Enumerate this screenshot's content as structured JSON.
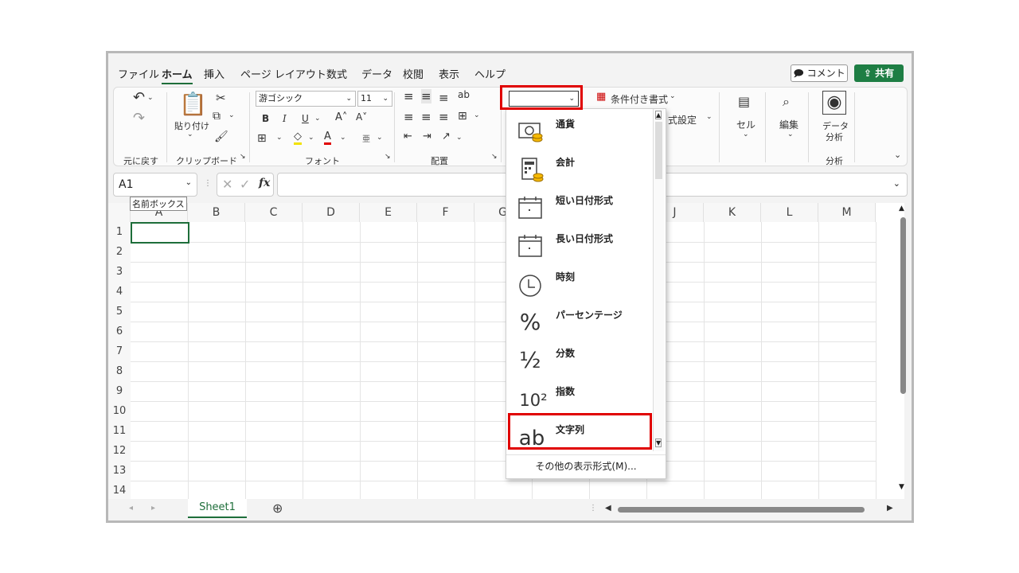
{
  "tabs": [
    "ファイル",
    "ホーム",
    "挿入",
    "ページ レイアウト",
    "数式",
    "データ",
    "校閲",
    "表示",
    "ヘルプ"
  ],
  "active_tab": "ホーム",
  "comment_label": "コメント",
  "share_label": "共有",
  "ribbon": {
    "undo_group": "元に戻す",
    "paste_label": "貼り付け",
    "clipboard_group": "クリップボード",
    "font_name": "游ゴシック",
    "font_size": "11",
    "font_group": "フォント",
    "align_group": "配置",
    "number_format_value": "",
    "conditional_format": "条件付き書式",
    "format_partial": "式設定",
    "cells_label": "セル",
    "edit_label": "編集",
    "data_analysis_1": "データ",
    "data_analysis_2": "分析",
    "analysis_group": "分析"
  },
  "formula_bar": {
    "name_box": "A1",
    "name_box_tooltip": "名前ボックス"
  },
  "columns": [
    "A",
    "B",
    "C",
    "D",
    "E",
    "F",
    "G",
    "H",
    "I",
    "J",
    "K",
    "L",
    "M"
  ],
  "rows": [
    "1",
    "2",
    "3",
    "4",
    "5",
    "6",
    "7",
    "8",
    "9",
    "10",
    "11",
    "12",
    "13",
    "14"
  ],
  "sheet_tab": "Sheet1",
  "number_format_menu": {
    "items": [
      {
        "label": "通貨",
        "icon": "currency-icon"
      },
      {
        "label": "会計",
        "icon": "accounting-icon"
      },
      {
        "label": "短い日付形式",
        "icon": "short-date-icon"
      },
      {
        "label": "長い日付形式",
        "icon": "long-date-icon"
      },
      {
        "label": "時刻",
        "icon": "clock-icon"
      },
      {
        "label": "パーセンテージ",
        "icon": "percent-icon"
      },
      {
        "label": "分数",
        "icon": "fraction-icon"
      },
      {
        "label": "指数",
        "icon": "scientific-icon"
      },
      {
        "label": "文字列",
        "icon": "text-icon"
      }
    ],
    "more": "その他の表示形式(M)...",
    "percent_glyph": "%",
    "fraction_glyph": "½",
    "scientific_glyph": "10²",
    "text_glyph": "ab"
  }
}
